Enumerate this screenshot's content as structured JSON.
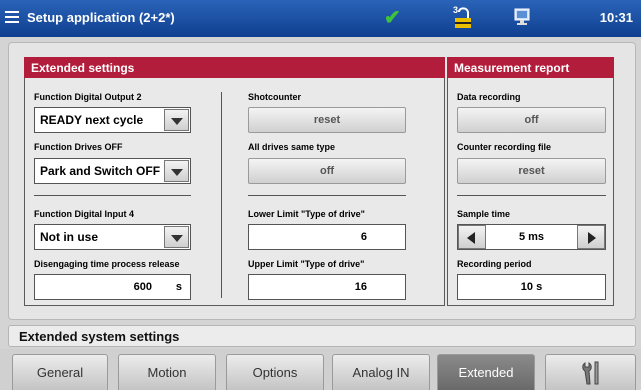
{
  "titlebar": {
    "title": "Setup application (2+2*)",
    "user_level": "3",
    "time": "10:31",
    "icons": [
      "menu-icon",
      "check-icon",
      "user-key-icon",
      "monitor-icon"
    ]
  },
  "extended": {
    "header": "Extended settings",
    "digital_output_2": {
      "label": "Function Digital Output 2",
      "value": "READY next cycle"
    },
    "drives_off": {
      "label": "Function Drives OFF",
      "value": "Park and Switch OFF"
    },
    "digital_input_4": {
      "label": "Function Digital Input 4",
      "value": "Not in use"
    },
    "disengaging_time": {
      "label": "Disengaging time process release",
      "value": "600",
      "unit": "s"
    },
    "shotcounter": {
      "label": "Shotcounter",
      "button": "reset"
    },
    "all_drives_same": {
      "label": "All drives same type",
      "button": "off"
    },
    "lower_limit": {
      "label": "Lower Limit \"Type of drive\"",
      "value": "6"
    },
    "upper_limit": {
      "label": "Upper Limit \"Type of drive\"",
      "value": "16"
    }
  },
  "measurement": {
    "header": "Measurement report",
    "data_recording": {
      "label": "Data recording",
      "button": "off"
    },
    "counter_file": {
      "label": "Counter recording file",
      "button": "reset"
    },
    "sample_time": {
      "label": "Sample time",
      "value": "5 ms"
    },
    "recording_period": {
      "label": "Recording period",
      "value": "10 s"
    }
  },
  "status": {
    "text": "Extended system settings"
  },
  "tabs": [
    {
      "label": "General"
    },
    {
      "label": "Motion"
    },
    {
      "label": "Options"
    },
    {
      "label": "Analog IN"
    },
    {
      "label": "Extended",
      "active": true
    }
  ],
  "colors": {
    "title_bar": "#1a4fa0",
    "panel_header": "#b31d3c",
    "check": "#3fc23f",
    "active_tab": "#7a7a7a"
  }
}
